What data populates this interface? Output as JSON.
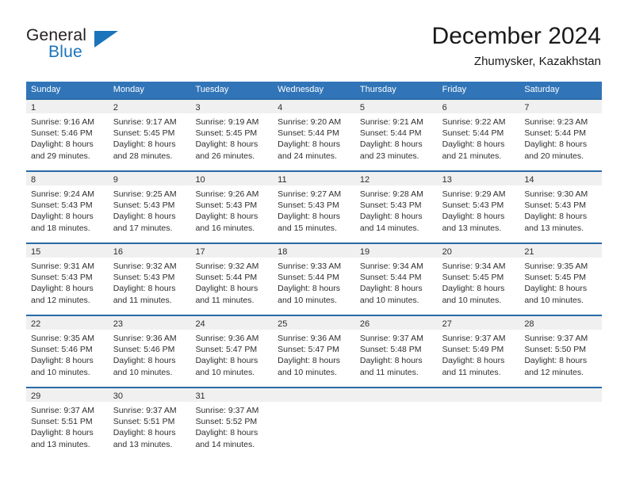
{
  "brand": {
    "name_top": "General",
    "name_bottom": "Blue",
    "accent_color": "#1b74bb",
    "logo_icon": "triangle-logo-icon"
  },
  "header": {
    "title": "December 2024",
    "subtitle": "Zhumysker, Kazakhstan"
  },
  "colors": {
    "header_blue": "#3175b8",
    "row_border_blue": "#2a6aa8",
    "day_band_gray": "#f0f0f0",
    "text": "#2e2e2e"
  },
  "weekdays": [
    "Sunday",
    "Monday",
    "Tuesday",
    "Wednesday",
    "Thursday",
    "Friday",
    "Saturday"
  ],
  "weeks": [
    [
      {
        "day": "1",
        "sunrise": "Sunrise: 9:16 AM",
        "sunset": "Sunset: 5:46 PM",
        "daylight_1": "Daylight: 8 hours",
        "daylight_2": "and 29 minutes."
      },
      {
        "day": "2",
        "sunrise": "Sunrise: 9:17 AM",
        "sunset": "Sunset: 5:45 PM",
        "daylight_1": "Daylight: 8 hours",
        "daylight_2": "and 28 minutes."
      },
      {
        "day": "3",
        "sunrise": "Sunrise: 9:19 AM",
        "sunset": "Sunset: 5:45 PM",
        "daylight_1": "Daylight: 8 hours",
        "daylight_2": "and 26 minutes."
      },
      {
        "day": "4",
        "sunrise": "Sunrise: 9:20 AM",
        "sunset": "Sunset: 5:44 PM",
        "daylight_1": "Daylight: 8 hours",
        "daylight_2": "and 24 minutes."
      },
      {
        "day": "5",
        "sunrise": "Sunrise: 9:21 AM",
        "sunset": "Sunset: 5:44 PM",
        "daylight_1": "Daylight: 8 hours",
        "daylight_2": "and 23 minutes."
      },
      {
        "day": "6",
        "sunrise": "Sunrise: 9:22 AM",
        "sunset": "Sunset: 5:44 PM",
        "daylight_1": "Daylight: 8 hours",
        "daylight_2": "and 21 minutes."
      },
      {
        "day": "7",
        "sunrise": "Sunrise: 9:23 AM",
        "sunset": "Sunset: 5:44 PM",
        "daylight_1": "Daylight: 8 hours",
        "daylight_2": "and 20 minutes."
      }
    ],
    [
      {
        "day": "8",
        "sunrise": "Sunrise: 9:24 AM",
        "sunset": "Sunset: 5:43 PM",
        "daylight_1": "Daylight: 8 hours",
        "daylight_2": "and 18 minutes."
      },
      {
        "day": "9",
        "sunrise": "Sunrise: 9:25 AM",
        "sunset": "Sunset: 5:43 PM",
        "daylight_1": "Daylight: 8 hours",
        "daylight_2": "and 17 minutes."
      },
      {
        "day": "10",
        "sunrise": "Sunrise: 9:26 AM",
        "sunset": "Sunset: 5:43 PM",
        "daylight_1": "Daylight: 8 hours",
        "daylight_2": "and 16 minutes."
      },
      {
        "day": "11",
        "sunrise": "Sunrise: 9:27 AM",
        "sunset": "Sunset: 5:43 PM",
        "daylight_1": "Daylight: 8 hours",
        "daylight_2": "and 15 minutes."
      },
      {
        "day": "12",
        "sunrise": "Sunrise: 9:28 AM",
        "sunset": "Sunset: 5:43 PM",
        "daylight_1": "Daylight: 8 hours",
        "daylight_2": "and 14 minutes."
      },
      {
        "day": "13",
        "sunrise": "Sunrise: 9:29 AM",
        "sunset": "Sunset: 5:43 PM",
        "daylight_1": "Daylight: 8 hours",
        "daylight_2": "and 13 minutes."
      },
      {
        "day": "14",
        "sunrise": "Sunrise: 9:30 AM",
        "sunset": "Sunset: 5:43 PM",
        "daylight_1": "Daylight: 8 hours",
        "daylight_2": "and 13 minutes."
      }
    ],
    [
      {
        "day": "15",
        "sunrise": "Sunrise: 9:31 AM",
        "sunset": "Sunset: 5:43 PM",
        "daylight_1": "Daylight: 8 hours",
        "daylight_2": "and 12 minutes."
      },
      {
        "day": "16",
        "sunrise": "Sunrise: 9:32 AM",
        "sunset": "Sunset: 5:43 PM",
        "daylight_1": "Daylight: 8 hours",
        "daylight_2": "and 11 minutes."
      },
      {
        "day": "17",
        "sunrise": "Sunrise: 9:32 AM",
        "sunset": "Sunset: 5:44 PM",
        "daylight_1": "Daylight: 8 hours",
        "daylight_2": "and 11 minutes."
      },
      {
        "day": "18",
        "sunrise": "Sunrise: 9:33 AM",
        "sunset": "Sunset: 5:44 PM",
        "daylight_1": "Daylight: 8 hours",
        "daylight_2": "and 10 minutes."
      },
      {
        "day": "19",
        "sunrise": "Sunrise: 9:34 AM",
        "sunset": "Sunset: 5:44 PM",
        "daylight_1": "Daylight: 8 hours",
        "daylight_2": "and 10 minutes."
      },
      {
        "day": "20",
        "sunrise": "Sunrise: 9:34 AM",
        "sunset": "Sunset: 5:45 PM",
        "daylight_1": "Daylight: 8 hours",
        "daylight_2": "and 10 minutes."
      },
      {
        "day": "21",
        "sunrise": "Sunrise: 9:35 AM",
        "sunset": "Sunset: 5:45 PM",
        "daylight_1": "Daylight: 8 hours",
        "daylight_2": "and 10 minutes."
      }
    ],
    [
      {
        "day": "22",
        "sunrise": "Sunrise: 9:35 AM",
        "sunset": "Sunset: 5:46 PM",
        "daylight_1": "Daylight: 8 hours",
        "daylight_2": "and 10 minutes."
      },
      {
        "day": "23",
        "sunrise": "Sunrise: 9:36 AM",
        "sunset": "Sunset: 5:46 PM",
        "daylight_1": "Daylight: 8 hours",
        "daylight_2": "and 10 minutes."
      },
      {
        "day": "24",
        "sunrise": "Sunrise: 9:36 AM",
        "sunset": "Sunset: 5:47 PM",
        "daylight_1": "Daylight: 8 hours",
        "daylight_2": "and 10 minutes."
      },
      {
        "day": "25",
        "sunrise": "Sunrise: 9:36 AM",
        "sunset": "Sunset: 5:47 PM",
        "daylight_1": "Daylight: 8 hours",
        "daylight_2": "and 10 minutes."
      },
      {
        "day": "26",
        "sunrise": "Sunrise: 9:37 AM",
        "sunset": "Sunset: 5:48 PM",
        "daylight_1": "Daylight: 8 hours",
        "daylight_2": "and 11 minutes."
      },
      {
        "day": "27",
        "sunrise": "Sunrise: 9:37 AM",
        "sunset": "Sunset: 5:49 PM",
        "daylight_1": "Daylight: 8 hours",
        "daylight_2": "and 11 minutes."
      },
      {
        "day": "28",
        "sunrise": "Sunrise: 9:37 AM",
        "sunset": "Sunset: 5:50 PM",
        "daylight_1": "Daylight: 8 hours",
        "daylight_2": "and 12 minutes."
      }
    ],
    [
      {
        "day": "29",
        "sunrise": "Sunrise: 9:37 AM",
        "sunset": "Sunset: 5:51 PM",
        "daylight_1": "Daylight: 8 hours",
        "daylight_2": "and 13 minutes."
      },
      {
        "day": "30",
        "sunrise": "Sunrise: 9:37 AM",
        "sunset": "Sunset: 5:51 PM",
        "daylight_1": "Daylight: 8 hours",
        "daylight_2": "and 13 minutes."
      },
      {
        "day": "31",
        "sunrise": "Sunrise: 9:37 AM",
        "sunset": "Sunset: 5:52 PM",
        "daylight_1": "Daylight: 8 hours",
        "daylight_2": "and 14 minutes."
      },
      {
        "day": "",
        "sunrise": "",
        "sunset": "",
        "daylight_1": "",
        "daylight_2": ""
      },
      {
        "day": "",
        "sunrise": "",
        "sunset": "",
        "daylight_1": "",
        "daylight_2": ""
      },
      {
        "day": "",
        "sunrise": "",
        "sunset": "",
        "daylight_1": "",
        "daylight_2": ""
      },
      {
        "day": "",
        "sunrise": "",
        "sunset": "",
        "daylight_1": "",
        "daylight_2": ""
      }
    ]
  ]
}
